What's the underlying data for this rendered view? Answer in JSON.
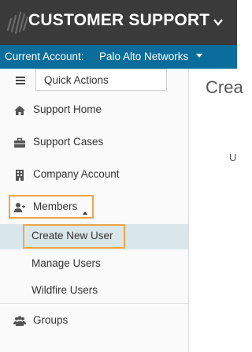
{
  "header": {
    "title": "CUSTOMER SUPPORT",
    "logo_icon": "brand-logo-icon",
    "menu_icon": "chevron-down-icon"
  },
  "account": {
    "label": "Current Account:",
    "value": "Palo Alto Networks"
  },
  "sidebar": {
    "quick_actions": "Quick Actions",
    "items": [
      {
        "label": "Support Home",
        "icon": "home-icon"
      },
      {
        "label": "Support Cases",
        "icon": "briefcase-icon"
      },
      {
        "label": "Company Account",
        "icon": "building-icon"
      },
      {
        "label": "Members",
        "icon": "add-user-icon",
        "expanded": true
      },
      {
        "label": "Groups",
        "icon": "users-group-icon"
      }
    ],
    "sub_items": [
      {
        "label": "Create New User",
        "active": true
      },
      {
        "label": "Manage Users"
      },
      {
        "label": "Wildfire Users"
      }
    ]
  },
  "main": {
    "title": "Crea",
    "fragment": "U"
  },
  "colors": {
    "topbar": "#3a3a3a",
    "accountbar": "#0b6d9b",
    "highlight": "#f0a54a",
    "active_row": "#d9e7ea"
  }
}
